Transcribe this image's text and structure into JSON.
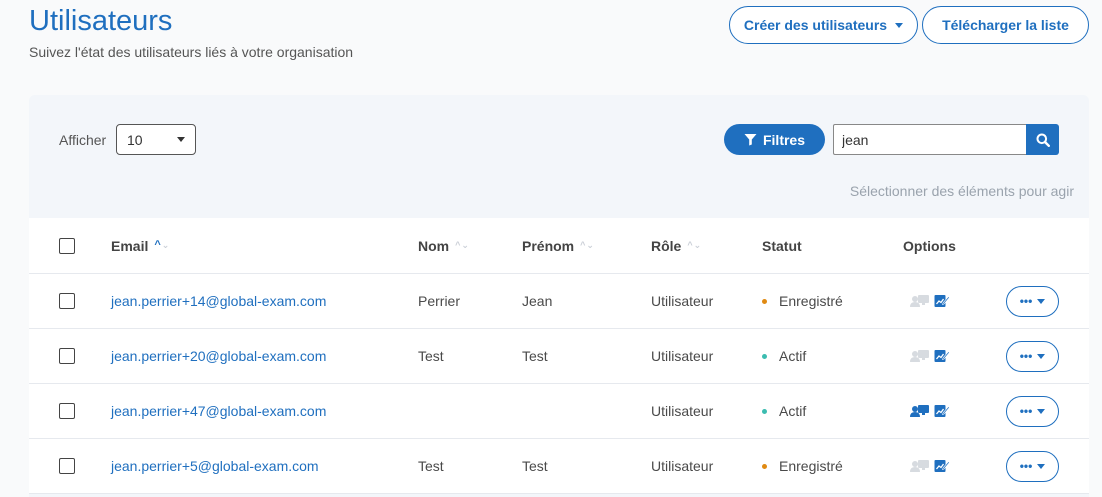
{
  "header": {
    "title": "Utilisateurs",
    "subtitle": "Suivez l'état des utilisateurs liés à votre organisation",
    "create_label": "Créer des utilisateurs",
    "download_label": "Télécharger la liste"
  },
  "toolbar": {
    "show_label": "Afficher",
    "page_size": "10",
    "filters_label": "Filtres",
    "search_value": "jean",
    "bulk_hint": "Sélectionner des éléments pour agir"
  },
  "table": {
    "columns": {
      "email": "Email",
      "nom": "Nom",
      "prenom": "Prénom",
      "role": "Rôle",
      "statut": "Statut",
      "options": "Options"
    },
    "rows": [
      {
        "email": "jean.perrier+14@global-exam.com",
        "nom": "Perrier",
        "prenom": "Jean",
        "role": "Utilisateur",
        "status": "Enregistré",
        "status_color": "#e08a12",
        "user_icon_active": false
      },
      {
        "email": "jean.perrier+20@global-exam.com",
        "nom": "Test",
        "prenom": "Test",
        "role": "Utilisateur",
        "status": "Actif",
        "status_color": "#3bbcb0",
        "user_icon_active": false
      },
      {
        "email": "jean.perrier+47@global-exam.com",
        "nom": "",
        "prenom": "",
        "role": "Utilisateur",
        "status": "Actif",
        "status_color": "#3bbcb0",
        "user_icon_active": true
      },
      {
        "email": "jean.perrier+5@global-exam.com",
        "nom": "Test",
        "prenom": "Test",
        "role": "Utilisateur",
        "status": "Enregistré",
        "status_color": "#e08a12",
        "user_icon_active": false
      }
    ],
    "more_label": "•••"
  },
  "colors": {
    "accent": "#1f6fbf",
    "status_registered": "#e08a12",
    "status_active": "#3bbcb0",
    "icon_inactive": "#d7dbe0"
  },
  "icons": {
    "filter": "filter-icon",
    "search": "search-icon",
    "user_monitor": "user-monitor-icon",
    "edit_chart": "edit-chart-icon"
  }
}
